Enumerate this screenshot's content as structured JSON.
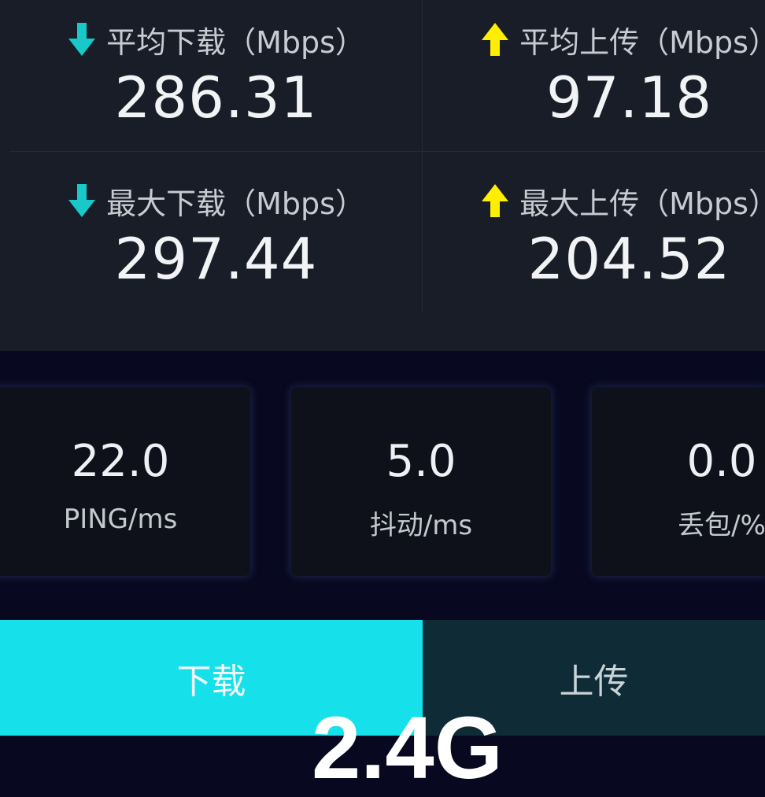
{
  "stats": {
    "avg_download": {
      "label": "平均下载（Mbps）",
      "value": "286.31",
      "icon": "download-arrow-icon"
    },
    "avg_upload": {
      "label": "平均上传（Mbps）",
      "value": "97.18",
      "icon": "upload-arrow-icon"
    },
    "max_download": {
      "label": "最大下载（Mbps）",
      "value": "297.44",
      "icon": "download-arrow-icon"
    },
    "max_upload": {
      "label": "最大上传（Mbps）",
      "value": "204.52",
      "icon": "upload-arrow-icon"
    }
  },
  "metrics": {
    "ping": {
      "value": "22.0",
      "label": "PING/ms"
    },
    "jitter": {
      "value": "5.0",
      "label": "抖动/ms"
    },
    "loss": {
      "value": "0.0",
      "label": "丢包/%"
    }
  },
  "tabs": {
    "download": "下载",
    "upload": "上传"
  },
  "band": "2.4G",
  "colors": {
    "download_accent": "#16e0e9",
    "download_arrow": "#19c9c9",
    "upload_arrow": "#ffee00",
    "panel_bg": "#181d27",
    "page_bg": "#080920",
    "upload_tab_bg": "#0f2c36"
  }
}
